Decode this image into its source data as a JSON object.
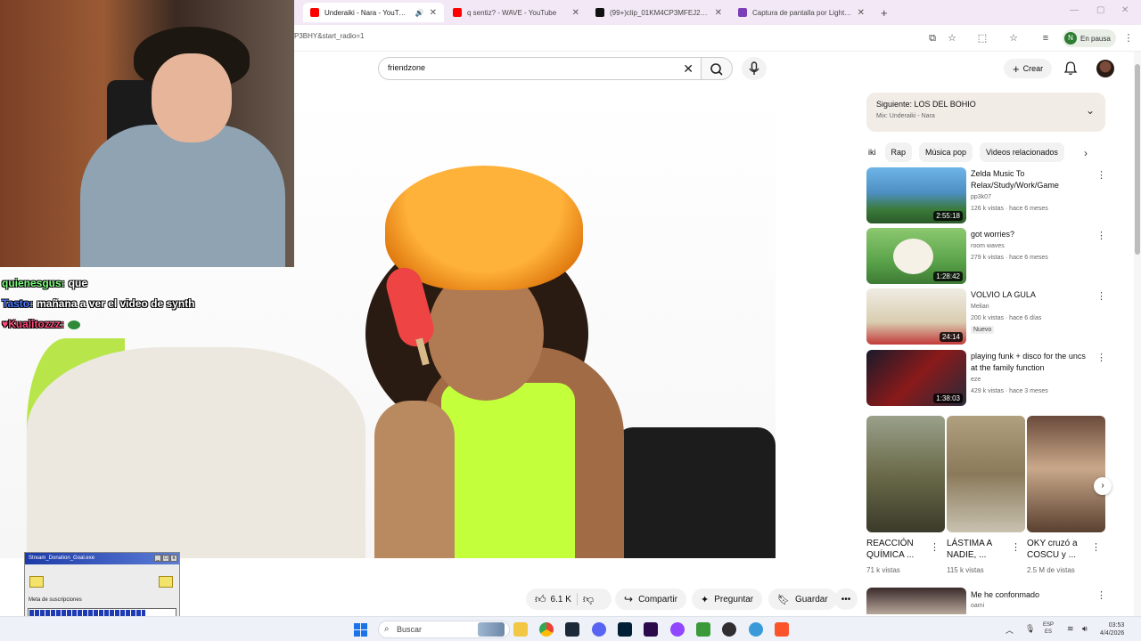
{
  "browser": {
    "tabs": [
      {
        "label": "Underaiki - Nara - YouTube",
        "active": true,
        "icon": "youtube-icon",
        "color": "#ff0000"
      },
      {
        "label": "q sentiz? - WAVE - YouTube",
        "active": false,
        "icon": "youtube-icon",
        "color": "#ff0000"
      },
      {
        "label": "(99+)clip_01KM4CP3MFEJ24DP",
        "active": false,
        "icon": "tiktok-icon",
        "color": "#111111"
      },
      {
        "label": "Captura de pantalla por Lightsh",
        "active": false,
        "icon": "lightshot-icon",
        "color": "#7b3fb8"
      }
    ],
    "new_tab": "+",
    "url": "P3BHY&start_radio=1",
    "profile": {
      "initial": "N",
      "status": "En pausa"
    }
  },
  "youtube": {
    "search": {
      "value": "friendzone",
      "placeholder": "Buscar"
    },
    "create_label": "Crear"
  },
  "chat": [
    {
      "user": "quienesgus:",
      "message": "que",
      "color": "#7cff7c"
    },
    {
      "user": "Tasto:",
      "message": "mañana a ver el video de synth",
      "color": "#4a78ff"
    },
    {
      "user": "Kualitozzz:",
      "message": "",
      "color": "#ff4a7a"
    }
  ],
  "donation_goal": {
    "window_title": "Stream_Donation_Goal.exe",
    "label": "Meta de suscripciones",
    "progress": 0.8
  },
  "actions": {
    "likes": "6.1 K",
    "share": "Compartir",
    "ask": "Preguntar",
    "save": "Guardar"
  },
  "playlist": {
    "next": "Siguiente: LOS DEL BOHIO",
    "mix": "Mix: Underaiki - Nara"
  },
  "chips": [
    "iki",
    "Rap",
    "Música pop",
    "Videos relacionados"
  ],
  "recommendations": [
    {
      "title": "Zelda Music To Relax/Study/Work/Game",
      "channel": "pp3k07",
      "meta": "126 k vistas · hace 6 meses",
      "duration": "2:55:18",
      "badge": "",
      "thumb": "#5a8fc7"
    },
    {
      "title": "got worries?",
      "channel": "room waves",
      "meta": "279 k vistas · hace 6 meses",
      "duration": "1:28:42",
      "badge": "",
      "thumb": "#6aa24a"
    },
    {
      "title": "VOLVIO LA GULA",
      "channel": "Melian",
      "meta": "200 k vistas · hace 6 días",
      "duration": "24:14",
      "badge": "Nuevo",
      "thumb": "#d4c6a8"
    },
    {
      "title": "playing funk + disco for the uncs at the family function",
      "channel": "eze",
      "meta": "429 k vistas · hace 3 meses",
      "duration": "1:38:03",
      "badge": "",
      "thumb": "#8a1a1a"
    }
  ],
  "shorts": [
    {
      "title": "REACCIÓN QUÍMICA ...",
      "views": "71 k vistas",
      "thumb": "#6b6b4a"
    },
    {
      "title": "LÁSTIMA A NADIE, ...",
      "views": "115 k vistas",
      "thumb": "#8a7a5a"
    },
    {
      "title": "OKY cruzó a COSCU y ...",
      "views": "2.5 M de vistas",
      "thumb": "#c9a88a"
    }
  ],
  "last_recommendation": {
    "title": "Me he confonmado",
    "channel": "oami"
  },
  "taskbar": {
    "search_label": "Buscar",
    "lang": [
      "ESP",
      "ES"
    ],
    "time": "03:53",
    "date": "4/4/2026"
  }
}
